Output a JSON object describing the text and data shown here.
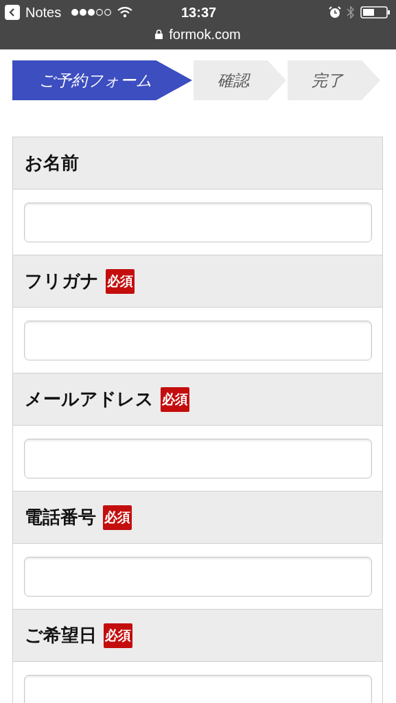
{
  "status_bar": {
    "back_label": "Notes",
    "time": "13:37",
    "url": "formok.com"
  },
  "steps": [
    {
      "label": "ご予約フォーム",
      "selected": true
    },
    {
      "label": "確認",
      "selected": false
    },
    {
      "label": "完了",
      "selected": false
    }
  ],
  "fields": [
    {
      "label": "お名前",
      "required": false
    },
    {
      "label": "フリガナ",
      "required": true,
      "badge": "必須"
    },
    {
      "label": "メールアドレス",
      "required": true,
      "badge": "必須"
    },
    {
      "label": "電話番号",
      "required": true,
      "badge": "必須"
    },
    {
      "label": "ご希望日",
      "required": true,
      "badge": "必須"
    }
  ]
}
